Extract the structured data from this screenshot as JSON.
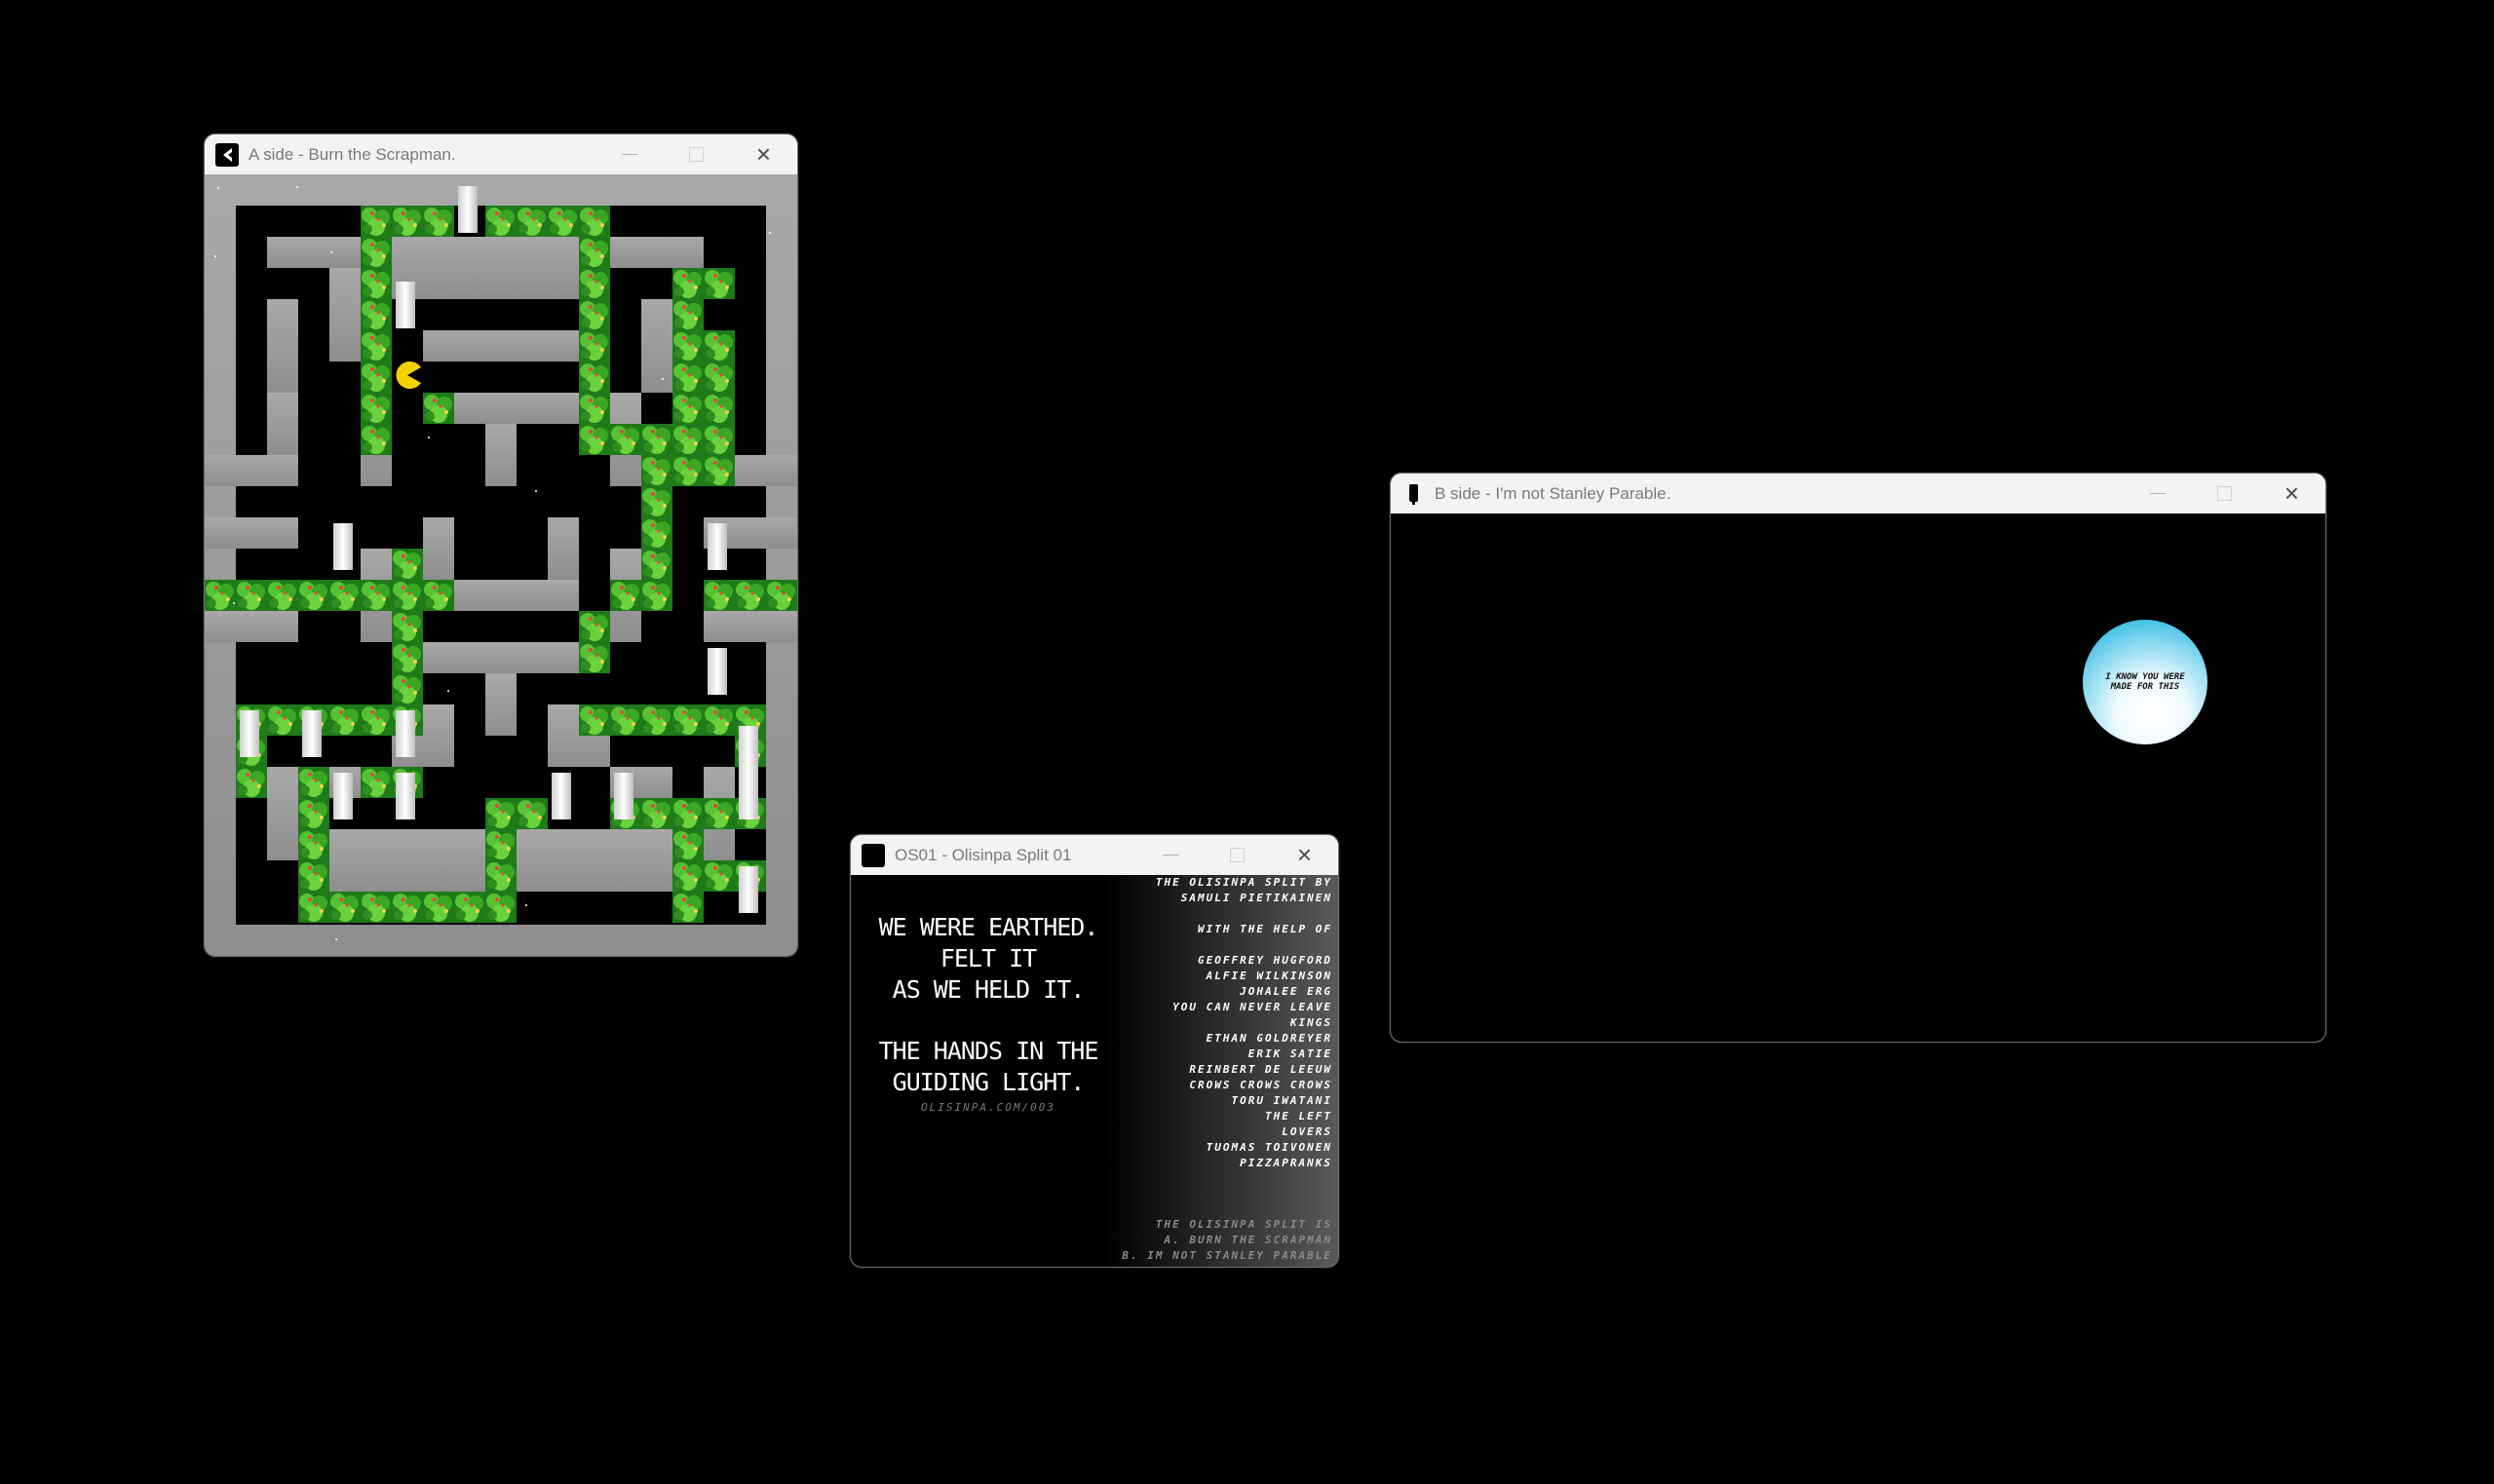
{
  "windows": {
    "a_side": {
      "title": "A side - Burn the Scrapman."
    },
    "b_side": {
      "title": "B side - I'm not Stanley Parable.",
      "orb_text": "I KNOW YOU WERE MADE FOR THIS"
    },
    "os01": {
      "title": "OS01 - Olisinpa Split 01",
      "poem_1": [
        "WE WERE EARTHED.",
        "FELT IT",
        "AS WE HELD IT."
      ],
      "poem_2": [
        "THE HANDS IN THE",
        "GUIDING LIGHT."
      ],
      "url": "OLISINPA.COM/003",
      "credits": [
        "THE OLISINPA SPLIT BY",
        "SAMULI PIETIKAINEN",
        "",
        "WITH THE HELP OF",
        "",
        "GEOFFREY HUGFORD",
        "ALFIE WILKINSON",
        "JOHALEE ERG",
        "YOU CAN NEVER LEAVE",
        "KINGS",
        "ETHAN GOLDREYER",
        "ERIK SATIE",
        "REINBERT DE LEEUW",
        "CROWS CROWS CROWS",
        "TORU IWATANI",
        "THE LEFT",
        "LOVERS",
        "TUOMAS TOIVONEN",
        "PIZZAPRANKS"
      ],
      "tail": [
        "THE OLISINPA SPLIT IS",
        "A. BURN THE SCRAPMAN",
        "B. IM NOT STANLEY PARABLE"
      ]
    }
  },
  "controls": {
    "minimize": "—",
    "maximize": "☐",
    "close": "✕"
  },
  "game": {
    "player": "pac-man",
    "map": "maze with bushes and white columns"
  }
}
